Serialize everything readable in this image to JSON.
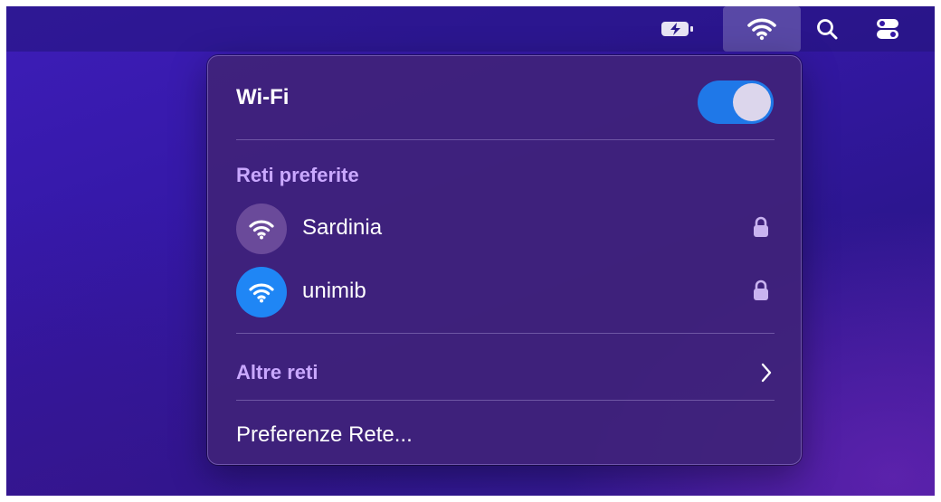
{
  "menubar": {
    "icons": [
      "battery-charging-icon",
      "wifi-icon",
      "search-icon",
      "control-center-icon"
    ]
  },
  "wifi_panel": {
    "title": "Wi-Fi",
    "toggle_on": true,
    "preferred_label": "Reti preferite",
    "networks": [
      {
        "name": "Sardinia",
        "connected": false,
        "locked": true,
        "icon_color": "#6a4a9a"
      },
      {
        "name": "unimib",
        "connected": true,
        "locked": true,
        "icon_color": "#1f86f5"
      }
    ],
    "other_networks_label": "Altre reti",
    "preferences_label": "Preferenze Rete..."
  },
  "colors": {
    "accent": "#1f78e8",
    "section_label": "#c9a8ff"
  }
}
